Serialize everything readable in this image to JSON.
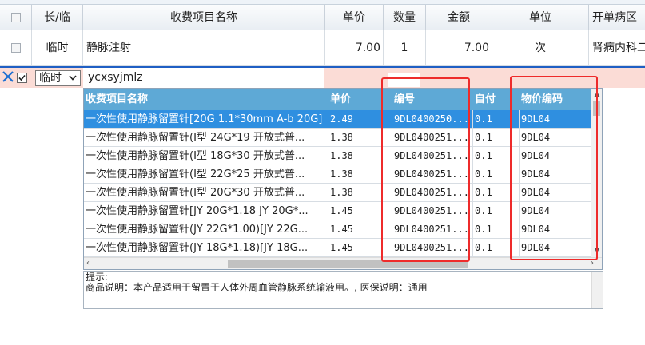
{
  "grid": {
    "columns": [
      "长/临",
      "收费项目名称",
      "单价",
      "数量",
      "金额",
      "单位",
      "开单病区"
    ],
    "row": {
      "type": "临时",
      "name": "静脉注射",
      "price": "7.00",
      "qty": "1",
      "amount": "7.00",
      "unit": "次",
      "ward": "肾病内科二"
    }
  },
  "edit_row": {
    "type_select": "临时",
    "code_input": "ycxsyjmlz"
  },
  "dropdown": {
    "headers": {
      "name": "收费项目名称",
      "price": "单价",
      "code": "编号",
      "self_pay": "自付",
      "price_code": "物价编码"
    },
    "rows": [
      {
        "name": "一次性使用静脉留置针[20G 1.1*30mm A-b 20G]",
        "price": "2.49",
        "code": "9DL0400250...",
        "self_pay": "0.1",
        "price_code": "9DL04"
      },
      {
        "name": "一次性使用静脉留置针(I型 24G*19 开放式普...",
        "price": "1.38",
        "code": "9DL0400251...",
        "self_pay": "0.1",
        "price_code": "9DL04"
      },
      {
        "name": "一次性使用静脉留置针(I型 18G*30 开放式普...",
        "price": "1.38",
        "code": "9DL0400251...",
        "self_pay": "0.1",
        "price_code": "9DL04"
      },
      {
        "name": "一次性使用静脉留置针(I型 22G*25 开放式普...",
        "price": "1.38",
        "code": "9DL0400251...",
        "self_pay": "0.1",
        "price_code": "9DL04"
      },
      {
        "name": "一次性使用静脉留置针(I型 20G*30 开放式普...",
        "price": "1.38",
        "code": "9DL0400251...",
        "self_pay": "0.1",
        "price_code": "9DL04"
      },
      {
        "name": "一次性使用静脉留置针[JY 20G*1.18 JY 20G*...",
        "price": "1.45",
        "code": "9DL0400251...",
        "self_pay": "0.1",
        "price_code": "9DL04"
      },
      {
        "name": "一次性使用静脉留置针(JY 22G*1.00)[JY 22G...",
        "price": "1.45",
        "code": "9DL0400251...",
        "self_pay": "0.1",
        "price_code": "9DL04"
      },
      {
        "name": "一次性使用静脉留置针(JY 18G*1.18)[JY 18G...",
        "price": "1.45",
        "code": "9DL0400251...",
        "self_pay": "0.1",
        "price_code": "9DL04"
      }
    ],
    "selected_index": 0
  },
  "hint": {
    "title": "提示:",
    "text": "商品说明：本产品适用于留置于人体外周血管静脉系统输液用。, 医保说明：通用"
  },
  "colors": {
    "selected_row": "#2f8fe0",
    "header_bg": "#5ea9d6",
    "edit_row_bg": "#fbdcd6",
    "annotation": "#ee2b2b"
  }
}
